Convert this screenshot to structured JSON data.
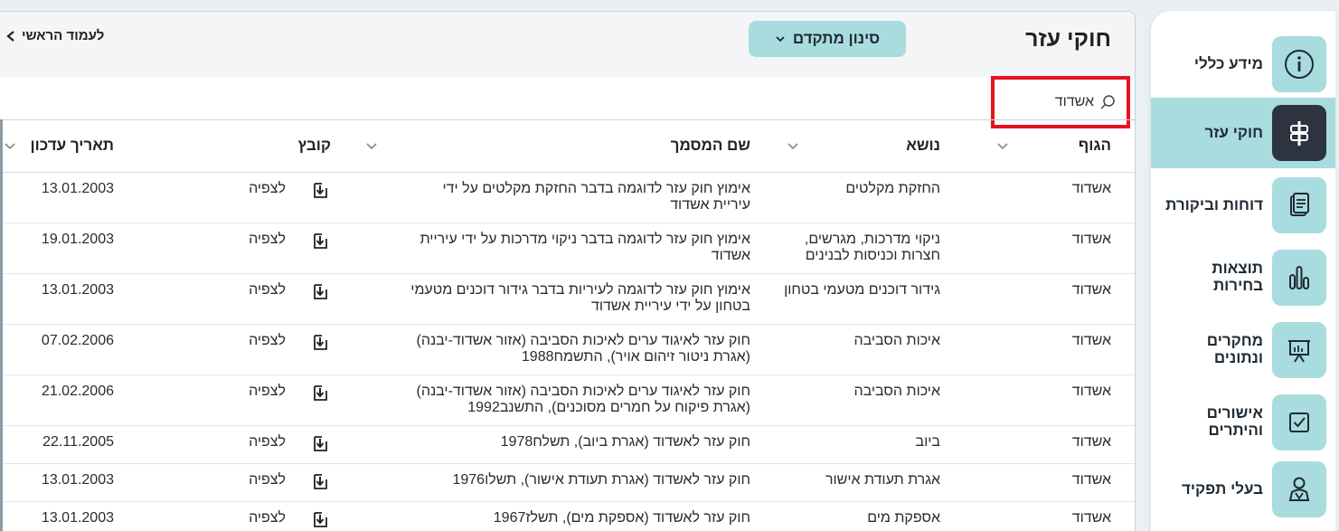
{
  "sidebar": {
    "items": [
      {
        "label": "מידע כללי",
        "icon": "info-icon",
        "active": false
      },
      {
        "label": "חוקי עזר",
        "icon": "signpost-icon",
        "active": true
      },
      {
        "label": "דוחות וביקורת",
        "icon": "documents-icon",
        "active": false
      },
      {
        "label": "תוצאות בחירות",
        "icon": "bar-chart-icon",
        "active": false
      },
      {
        "label": "מחקרים ונתונים",
        "icon": "presentation-icon",
        "active": false
      },
      {
        "label": "אישורים והיתרים",
        "icon": "checkbox-icon",
        "active": false
      },
      {
        "label": "בעלי תפקיד",
        "icon": "people-icon",
        "active": false
      }
    ]
  },
  "header": {
    "title": "חוקי עזר",
    "filter_label": "סינון מתקדם",
    "home_link": "לעמוד הראשי"
  },
  "search": {
    "value": "אשדוד",
    "placeholder": ""
  },
  "table": {
    "columns": [
      "הגוף",
      "נושא",
      "שם המסמך",
      "קובץ",
      "תאריך עדכון"
    ],
    "view_label": "לצפיה",
    "rows": [
      {
        "body": "אשדוד",
        "subject": "החזקת מקלטים",
        "doc_l1": "אימוץ חוק עזר לדוגמה בדבר החזקת מקלטים על ידי",
        "doc_l2": "עיריית אשדוד",
        "date": "13.01.2003"
      },
      {
        "body": "אשדוד",
        "subject_l1": "ניקוי מדרכות, מגרשים,",
        "subject_l2": "חצרות וכניסות לבנינים",
        "doc_l1": "אימוץ חוק עזר לדוגמה בדבר ניקוי מדרכות על ידי עיריית",
        "doc_l2": "אשדוד",
        "date": "19.01.2003"
      },
      {
        "body": "אשדוד",
        "subject": "גידור דוכנים מטעמי בטחון",
        "doc_l1": "אימוץ חוק עזר לדוגמה לעיריות בדבר גידור דוכנים מטעמי",
        "doc_l2": "בטחון על ידי עיריית אשדוד",
        "date": "13.01.2003"
      },
      {
        "body": "אשדוד",
        "subject": "איכות הסביבה",
        "doc_l1": "חוק עזר לאיגוד ערים לאיכות הסביבה (אזור אשדוד-יבנה)",
        "doc_l2": "(אגרת ניטור זיהום אויר), התשמח1988",
        "date": "07.02.2006"
      },
      {
        "body": "אשדוד",
        "subject": "איכות הסביבה",
        "doc_l1": "חוק עזר לאיגוד ערים לאיכות הסביבה (אזור אשדוד-יבנה)",
        "doc_l2": "(אגרת פיקוח על חמרים מסוכנים), התשנב1992",
        "date": "21.02.2006"
      },
      {
        "body": "אשדוד",
        "subject": "ביוב",
        "doc_l1": "חוק עזר לאשדוד (אגרת ביוב), תשלח1978",
        "date": "22.11.2005"
      },
      {
        "body": "אשדוד",
        "subject": "אגרת תעודת אישור",
        "doc_l1": "חוק עזר לאשדוד (אגרת תעודת אישור), תשלו1976",
        "date": "13.01.2003"
      },
      {
        "body": "אשדוד",
        "subject": "אספקת מים",
        "doc_l1": "חוק עזר לאשדוד (אספקת מים), תשלז1967",
        "date": "13.01.2003"
      }
    ]
  },
  "colors": {
    "accent": "#a8dcdf",
    "active_icon_bg": "#2d3440",
    "highlight_border": "#e8121e"
  }
}
